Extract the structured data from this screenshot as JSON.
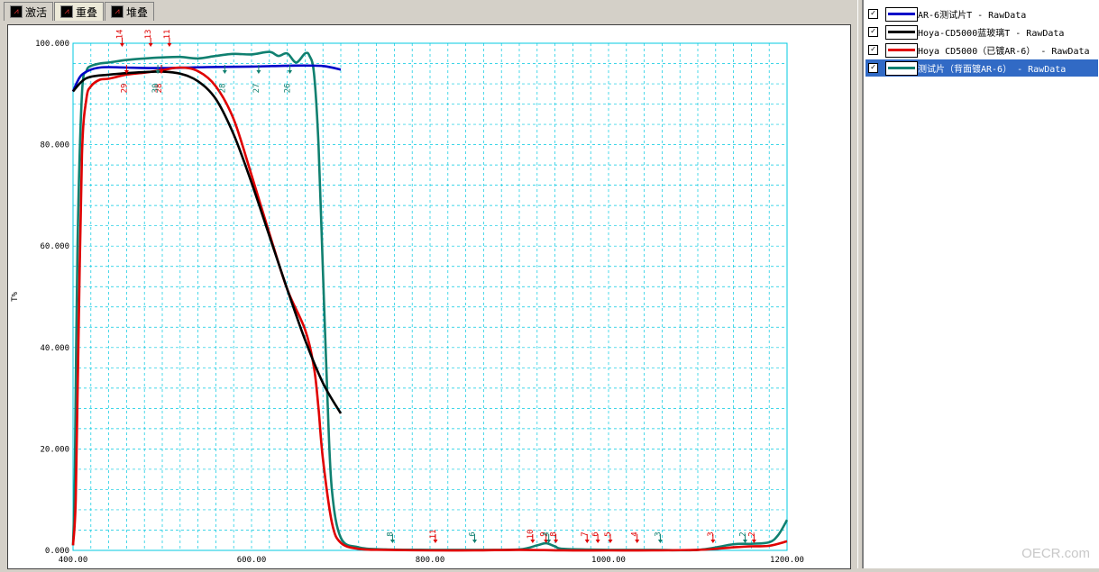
{
  "tabs": [
    {
      "label": "激活",
      "icon": "chart-icon"
    },
    {
      "label": "重叠",
      "icon": "overlay-chart-icon"
    },
    {
      "label": "堆叠",
      "icon": "stack-chart-icon"
    }
  ],
  "legend": [
    {
      "label": "AR-6测试片T - RawData",
      "color": "#0000c8",
      "checked": true,
      "selected": false
    },
    {
      "label": "Hoya-CD5000蓝玻璃T - RawData",
      "color": "#000000",
      "checked": true,
      "selected": false
    },
    {
      "label": "Hoya CD5000（已镀AR-6） - RawData",
      "color": "#e00000",
      "checked": true,
      "selected": false
    },
    {
      "label": "测试片（背面镀AR-6） - RawData",
      "color": "#108070",
      "checked": true,
      "selected": true
    }
  ],
  "watermark": "OECR.com",
  "chart_data": {
    "type": "line",
    "ylabel": "T%",
    "xlim": [
      400,
      1200
    ],
    "ylim": [
      0,
      100
    ],
    "x_ticks": [
      "400.00",
      "600.00",
      "800.00",
      "1000.00",
      "1200.00"
    ],
    "y_ticks": [
      "0.000",
      "20.000",
      "40.000",
      "60.000",
      "80.000",
      "100.000"
    ],
    "grid": true,
    "series": [
      {
        "name": "AR-6测试片T - RawData",
        "color": "#0000c8",
        "x": [
          400,
          405,
          410,
          420,
          430,
          440,
          460,
          500,
          550,
          600,
          650,
          680,
          700
        ],
        "y": [
          90.5,
          92.5,
          93.8,
          94.8,
          95.2,
          95.3,
          95.2,
          95.1,
          95.3,
          95.4,
          95.6,
          95.5,
          94.8
        ]
      },
      {
        "name": "Hoya-CD5000蓝玻璃T - RawData",
        "color": "#000000",
        "x": [
          400,
          410,
          420,
          440,
          460,
          480,
          500,
          520,
          540,
          560,
          580,
          600,
          620,
          640,
          660,
          680,
          700
        ],
        "y": [
          90.5,
          92.5,
          93.4,
          93.8,
          94.1,
          94.3,
          94.4,
          94.0,
          92.5,
          89.0,
          82.0,
          72.5,
          62.0,
          51.5,
          41.5,
          33.0,
          27.0
        ]
      },
      {
        "name": "Hoya CD5000（已镀AR-6） - RawData",
        "color": "#e00000",
        "x": [
          400,
          403,
          406,
          410,
          415,
          420,
          430,
          440,
          460,
          480,
          500,
          520,
          540,
          560,
          580,
          600,
          620,
          640,
          660,
          670,
          675,
          680,
          690,
          700,
          720,
          750,
          800,
          850,
          900,
          950,
          1000,
          1050,
          1100,
          1120,
          1140,
          1160,
          1180,
          1200
        ],
        "y": [
          1.0,
          10.0,
          40.0,
          78.0,
          89.0,
          91.5,
          92.8,
          93.0,
          93.8,
          94.2,
          94.7,
          95.2,
          94.5,
          91.5,
          85.0,
          74.0,
          62.5,
          51.5,
          43.5,
          36.0,
          28.0,
          18.0,
          5.5,
          1.5,
          0.3,
          0.1,
          0.0,
          0.0,
          0.1,
          0.0,
          0.0,
          0.0,
          0.1,
          0.3,
          0.6,
          0.8,
          0.9,
          1.8
        ]
      },
      {
        "name": "测试片（背面镀AR-6） - RawData",
        "color": "#108070",
        "x": [
          400,
          402,
          405,
          410,
          415,
          420,
          430,
          440,
          460,
          480,
          500,
          520,
          540,
          560,
          580,
          600,
          620,
          630,
          640,
          650,
          660,
          665,
          670,
          675,
          680,
          685,
          690,
          700,
          720,
          750,
          800,
          850,
          900,
          920,
          930,
          940,
          950,
          1000,
          1050,
          1100,
          1140,
          1160,
          1180,
          1190,
          1200
        ],
        "y": [
          1.0,
          15.0,
          60.0,
          90.0,
          94.5,
          95.5,
          96.0,
          96.2,
          96.7,
          97.0,
          97.2,
          97.3,
          97.0,
          97.5,
          97.9,
          97.8,
          98.3,
          97.5,
          98.0,
          96.2,
          98.0,
          97.5,
          94.0,
          80.0,
          55.0,
          30.0,
          12.0,
          2.5,
          0.6,
          0.2,
          0.1,
          0.1,
          0.2,
          1.0,
          1.4,
          0.8,
          0.3,
          0.1,
          0.1,
          0.1,
          1.2,
          1.3,
          1.6,
          3.0,
          6.0
        ]
      }
    ],
    "peak_markers": [
      {
        "label": "14",
        "x": 455,
        "color": "#e00000",
        "pos": "top"
      },
      {
        "label": "13",
        "x": 487,
        "color": "#e00000",
        "pos": "top"
      },
      {
        "label": "11",
        "x": 508,
        "color": "#e00000",
        "pos": "top"
      },
      {
        "label": "29",
        "x": 460,
        "color": "#e00000",
        "pos": "below"
      },
      {
        "label": "28",
        "x": 499,
        "color": "#e00000",
        "pos": "below"
      },
      {
        "label": "30",
        "x": 495,
        "color": "#108070",
        "pos": "below"
      },
      {
        "label": "28",
        "x": 570,
        "color": "#108070",
        "pos": "below"
      },
      {
        "label": "27",
        "x": 608,
        "color": "#108070",
        "pos": "below"
      },
      {
        "label": "26",
        "x": 643,
        "color": "#108070",
        "pos": "below"
      },
      {
        "label": "8",
        "x": 758,
        "color": "#108070",
        "pos": "bottom"
      },
      {
        "label": "11",
        "x": 806,
        "color": "#e00000",
        "pos": "bottom"
      },
      {
        "label": "6",
        "x": 850,
        "color": "#108070",
        "pos": "bottom"
      },
      {
        "label": "10",
        "x": 915,
        "color": "#e00000",
        "pos": "bottom"
      },
      {
        "label": "9",
        "x": 930,
        "color": "#e00000",
        "pos": "bottom"
      },
      {
        "label": "4",
        "x": 933,
        "color": "#108070",
        "pos": "bottom"
      },
      {
        "label": "8",
        "x": 941,
        "color": "#e00000",
        "pos": "bottom"
      },
      {
        "label": "7",
        "x": 976,
        "color": "#e00000",
        "pos": "bottom"
      },
      {
        "label": "6",
        "x": 988,
        "color": "#e00000",
        "pos": "bottom"
      },
      {
        "label": "5",
        "x": 1002,
        "color": "#e00000",
        "pos": "bottom"
      },
      {
        "label": "4",
        "x": 1032,
        "color": "#e00000",
        "pos": "bottom"
      },
      {
        "label": "3",
        "x": 1058,
        "color": "#108070",
        "pos": "bottom"
      },
      {
        "label": "3",
        "x": 1117,
        "color": "#e00000",
        "pos": "bottom"
      },
      {
        "label": "2",
        "x": 1153,
        "color": "#108070",
        "pos": "bottom"
      },
      {
        "label": "2",
        "x": 1163,
        "color": "#e00000",
        "pos": "bottom"
      }
    ]
  }
}
